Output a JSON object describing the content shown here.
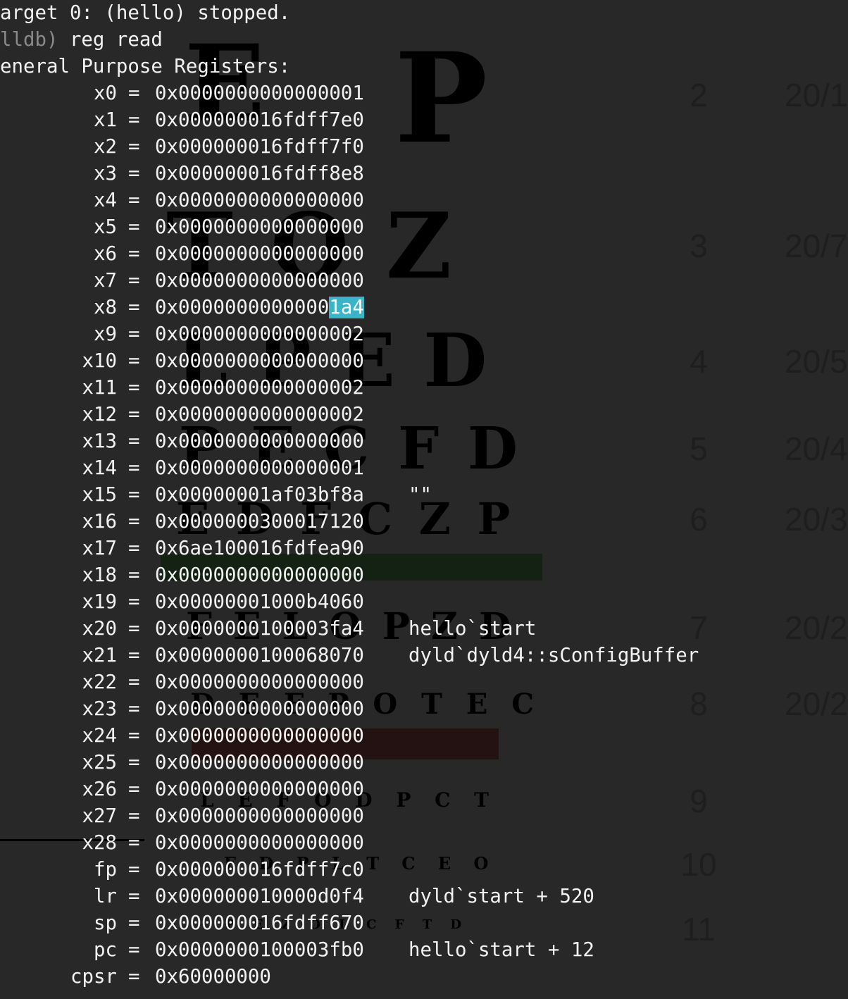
{
  "terminal": {
    "header": {
      "stop_line": "arget 0: (hello) stopped.",
      "prompt_prefix": "lldb)",
      "command": " reg read",
      "section_title": "eneral Purpose Registers:"
    },
    "registers": [
      {
        "name": "x0",
        "value": "0x0000000000000001",
        "note": ""
      },
      {
        "name": "x1",
        "value": "0x000000016fdff7e0",
        "note": ""
      },
      {
        "name": "x2",
        "value": "0x000000016fdff7f0",
        "note": ""
      },
      {
        "name": "x3",
        "value": "0x000000016fdff8e8",
        "note": ""
      },
      {
        "name": "x4",
        "value": "0x0000000000000000",
        "note": ""
      },
      {
        "name": "x5",
        "value": "0x0000000000000000",
        "note": ""
      },
      {
        "name": "x6",
        "value": "0x0000000000000000",
        "note": ""
      },
      {
        "name": "x7",
        "value": "0x0000000000000000",
        "note": ""
      },
      {
        "name": "x8",
        "value_prefix": "0x0000000000000",
        "value_highlight": "1a4",
        "note": ""
      },
      {
        "name": "x9",
        "value": "0x0000000000000002",
        "note": ""
      },
      {
        "name": "x10",
        "value": "0x0000000000000000",
        "note": ""
      },
      {
        "name": "x11",
        "value": "0x0000000000000002",
        "note": ""
      },
      {
        "name": "x12",
        "value": "0x0000000000000002",
        "note": ""
      },
      {
        "name": "x13",
        "value": "0x0000000000000000",
        "note": ""
      },
      {
        "name": "x14",
        "value": "0x0000000000000001",
        "note": ""
      },
      {
        "name": "x15",
        "value": "0x00000001af03bf8a",
        "note": "\"\""
      },
      {
        "name": "x16",
        "value": "0x0000000300017120",
        "note": ""
      },
      {
        "name": "x17",
        "value": "0x6ae100016fdfea90",
        "note": ""
      },
      {
        "name": "x18",
        "value": "0x0000000000000000",
        "note": ""
      },
      {
        "name": "x19",
        "value": "0x00000001000b4060",
        "note": ""
      },
      {
        "name": "x20",
        "value": "0x0000000100003fa4",
        "note": "hello`start"
      },
      {
        "name": "x21",
        "value": "0x0000000100068070",
        "note": "dyld`dyld4::sConfigBuffer"
      },
      {
        "name": "x22",
        "value": "0x0000000000000000",
        "note": ""
      },
      {
        "name": "x23",
        "value": "0x0000000000000000",
        "note": ""
      },
      {
        "name": "x24",
        "value": "0x0000000000000000",
        "note": ""
      },
      {
        "name": "x25",
        "value": "0x0000000000000000",
        "note": ""
      },
      {
        "name": "x26",
        "value": "0x0000000000000000",
        "note": ""
      },
      {
        "name": "x27",
        "value": "0x0000000000000000",
        "note": ""
      },
      {
        "name": "x28",
        "value": "0x0000000000000000",
        "note": ""
      },
      {
        "name": "fp",
        "value": "0x000000016fdff7c0",
        "note": ""
      },
      {
        "name": "lr",
        "value": "0x000000010000d0f4",
        "note": "dyld`start + 520"
      },
      {
        "name": "sp",
        "value": "0x000000016fdff670",
        "note": ""
      },
      {
        "name": "pc",
        "value": "0x0000000100003fb0",
        "note": "hello`start + 12"
      },
      {
        "name": "cpsr",
        "value": "0x60000000",
        "note": ""
      }
    ],
    "colors": {
      "background": "#282828",
      "text": "#f2f2f2",
      "prompt_dim": "#8a8a8a",
      "selection": "#3bb4c8"
    }
  },
  "background_chart": {
    "letter_rows": [
      "E",
      "P",
      "T O Z",
      "L P E D",
      "P E C F D",
      "E D F C Z P",
      "F E L O P Z D",
      "D E F P O T E C",
      "L E F O D P C T",
      "F D P L T C E O",
      "P E Z O L C F T D"
    ],
    "line_numbers": [
      "2",
      "3",
      "4",
      "5",
      "6",
      "7",
      "8",
      "9",
      "10",
      "11"
    ],
    "acuity": [
      "20/1",
      "20/7",
      "20/5",
      "20/4",
      "20/3",
      "20/2",
      "20/2"
    ],
    "colors": {
      "green_bar": "#142214",
      "red_bar": "#241212"
    }
  }
}
